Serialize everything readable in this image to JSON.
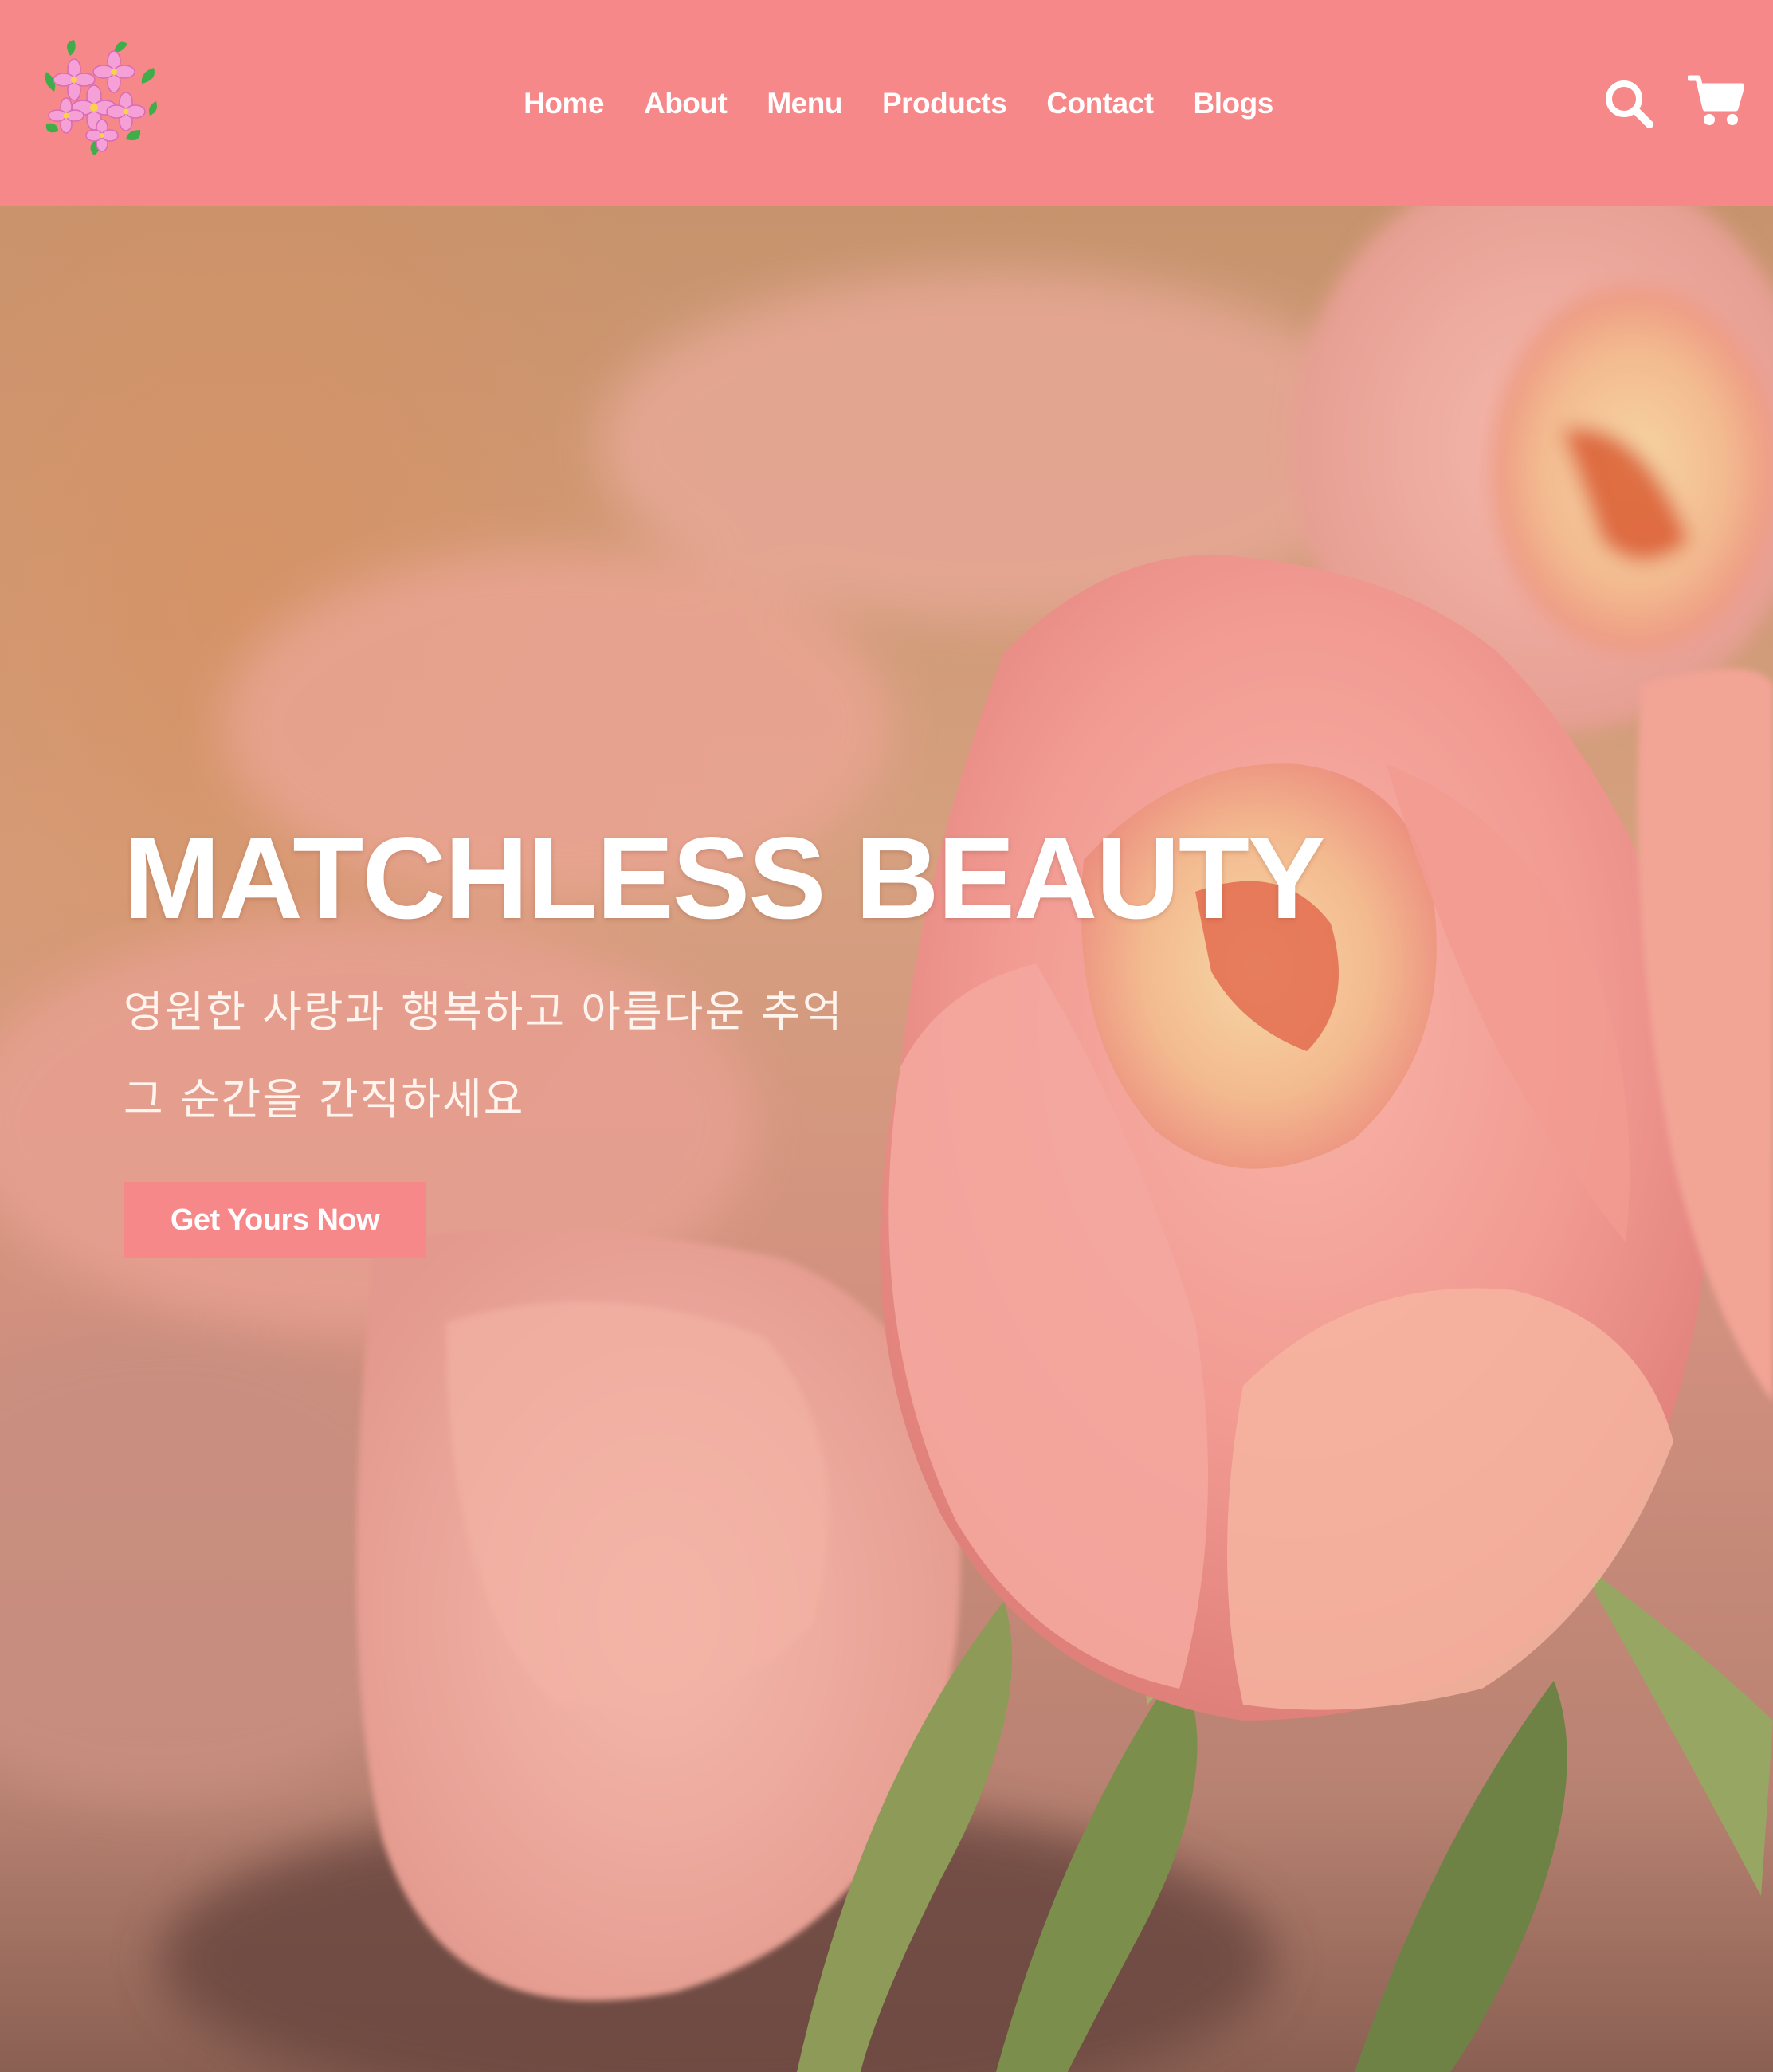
{
  "header": {
    "nav": [
      "Home",
      "About",
      "Menu",
      "Products",
      "Contact",
      "Blogs"
    ],
    "logo_icon": "flower-bouquet-logo",
    "search_icon": "search-icon",
    "cart_icon": "cart-icon",
    "background_color": "#f7888a"
  },
  "hero": {
    "title": "MATCHLESS BEAUTY",
    "subtitle_line1": "영원한 사랑과 행복하고 아름다운 추억",
    "subtitle_line2": "그 순간을 간직하세요",
    "cta_label": "Get Yours Now",
    "cta_color": "#f7888a"
  }
}
